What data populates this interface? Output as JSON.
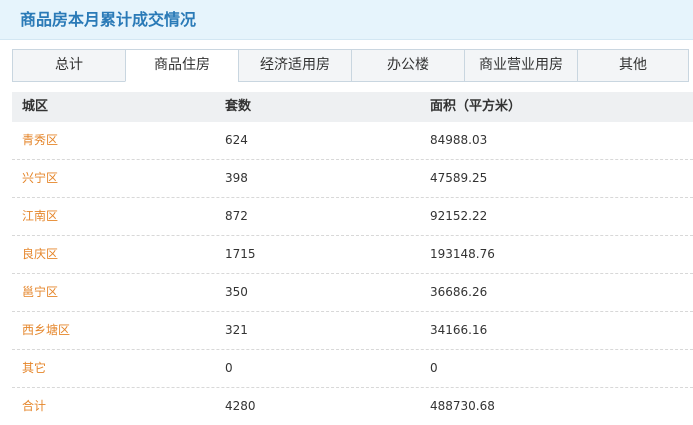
{
  "header": {
    "title": "商品房本月累计成交情况"
  },
  "tabs": [
    {
      "label": "总计"
    },
    {
      "label": "商品住房"
    },
    {
      "label": "经济适用房"
    },
    {
      "label": "办公楼"
    },
    {
      "label": "商业营业用房"
    },
    {
      "label": "其他"
    }
  ],
  "active_tab": "商品住房",
  "table": {
    "columns": [
      "城区",
      "套数",
      "面积（平方米）"
    ],
    "rows": [
      {
        "district": "青秀区",
        "units": "624",
        "area": "84988.03"
      },
      {
        "district": "兴宁区",
        "units": "398",
        "area": "47589.25"
      },
      {
        "district": "江南区",
        "units": "872",
        "area": "92152.22"
      },
      {
        "district": "良庆区",
        "units": "1715",
        "area": "193148.76"
      },
      {
        "district": "邕宁区",
        "units": "350",
        "area": "36686.26"
      },
      {
        "district": "西乡塘区",
        "units": "321",
        "area": "34166.16"
      },
      {
        "district": "其它",
        "units": "0",
        "area": "0"
      },
      {
        "district": "合计",
        "units": "4280",
        "area": "488730.68"
      }
    ]
  },
  "colors": {
    "title": "#2a7ab7",
    "title_bg": "#e6f4fc",
    "link": "#e5862b",
    "header_bg": "#eef0f2"
  }
}
